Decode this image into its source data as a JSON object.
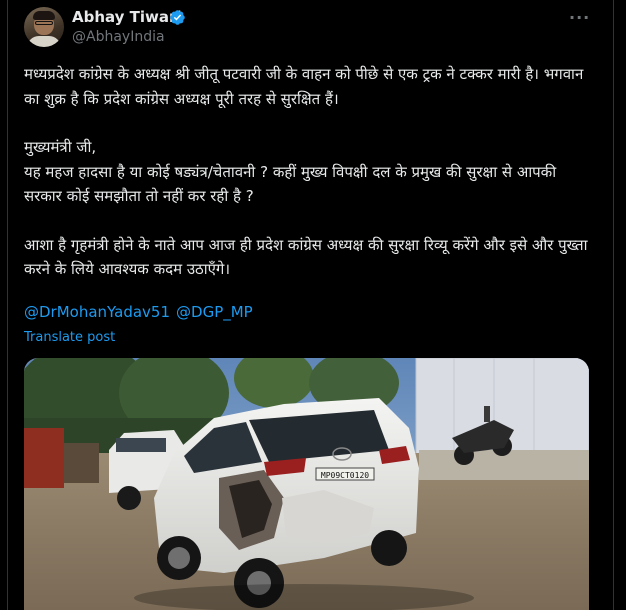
{
  "author": {
    "name": "Abhay Tiwari",
    "handle": "@AbhayIndia"
  },
  "tweet": {
    "paragraphs": [
      "मध्यप्रदेश कांग्रेस के अध्यक्ष श्री जीतू पटवारी जी के वाहन को पीछे से एक ट्रक ने टक्कर मारी है। भगवान का शुक्र है कि प्रदेश कांग्रेस अध्यक्ष पूरी तरह से सुरक्षित हैं।",
      "मुख्यमंत्री जी,",
      "यह महज हादसा है या कोई षड्यंत्र/चेतावनी ? कहीं मुख्य विपक्षी दल के प्रमुख की सुरक्षा से आपकी सरकार कोई समझौता तो नहीं कर रही है ?",
      "आशा है गृहमंत्री होने के नाते आप आज ही प्रदेश कांग्रेस अध्यक्ष की सुरक्षा रिव्यू करेंगे और इसे और पुख्ता करने के लिये आवश्यक कदम उठाएँगे।"
    ],
    "mentions": [
      "@DrMohanYadav51",
      "@DGP_MP"
    ],
    "translate_label": "Translate post"
  },
  "photo": {
    "plate": "MP09CT0120"
  },
  "colors": {
    "background": "#000000",
    "text": "#e7e9ea",
    "muted": "#71767b",
    "link": "#1d9bf0",
    "verified": "#1d9bf0"
  },
  "icons": {
    "verified": "verified-badge-icon",
    "more": "more-options-icon"
  }
}
